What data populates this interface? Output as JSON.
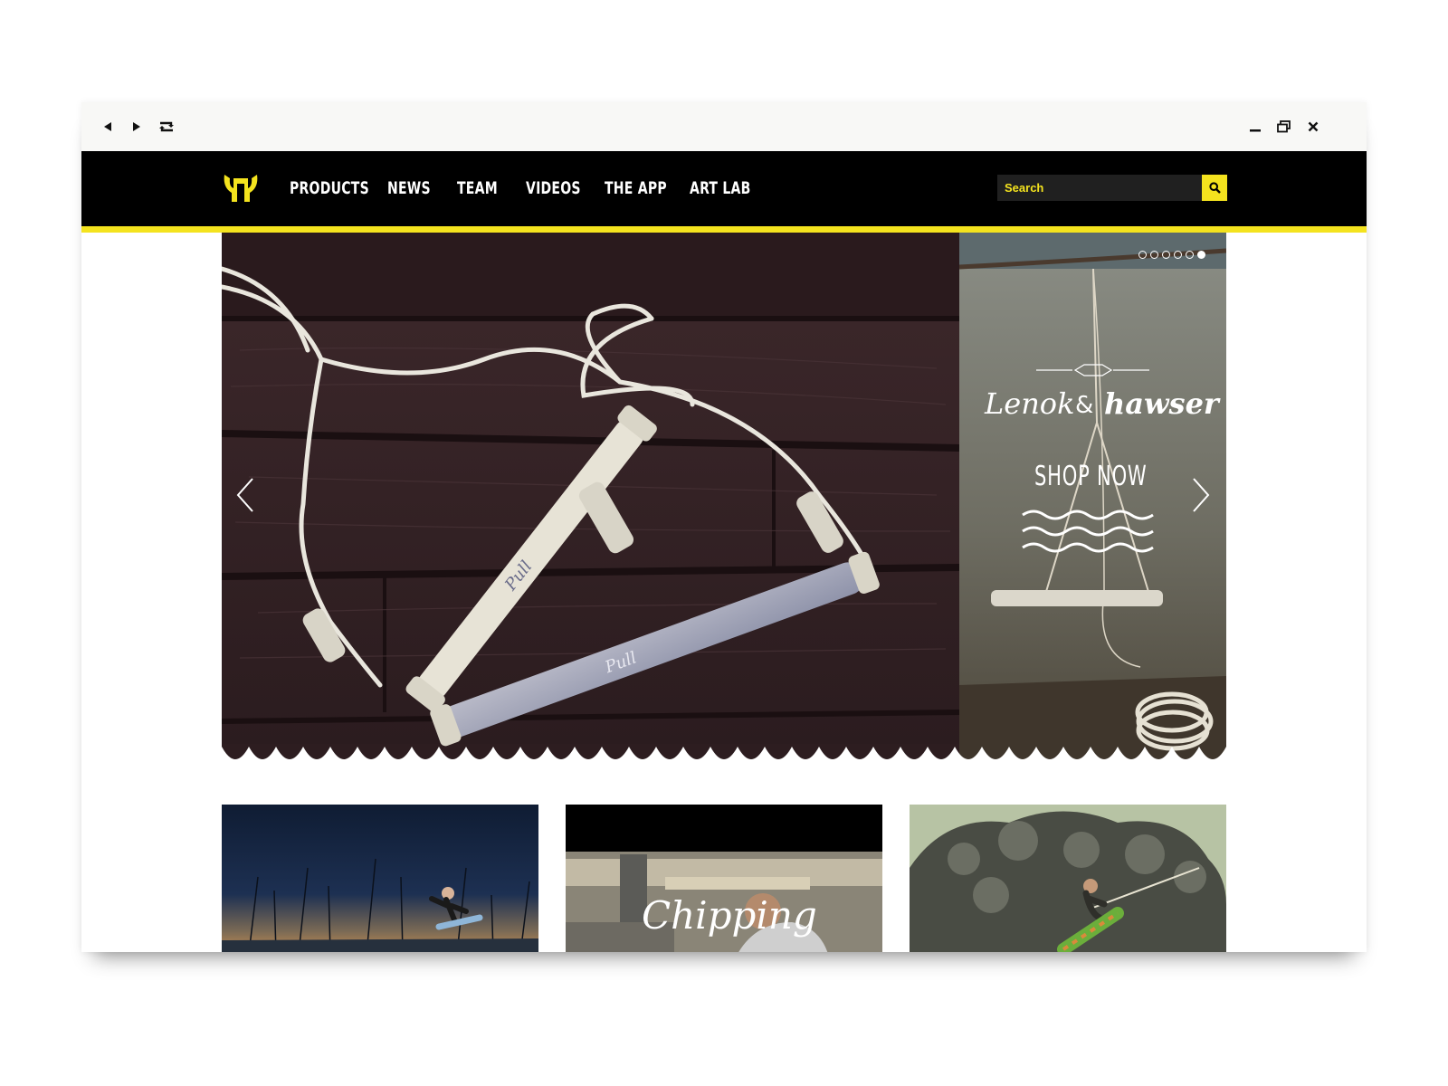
{
  "window": {
    "controls": [
      "back-icon",
      "forward-icon",
      "repeat-icon",
      "minimize-icon",
      "restore-icon",
      "close-icon"
    ]
  },
  "nav": {
    "items": [
      {
        "label": "PRODUCTS"
      },
      {
        "label": "NEWS"
      },
      {
        "label": "TEAM"
      },
      {
        "label": "VIDEOS"
      },
      {
        "label": "THE APP"
      },
      {
        "label": "ART LAB"
      }
    ],
    "search_placeholder": "Search"
  },
  "colors": {
    "accent": "#f4e31e",
    "navbar": "#000000"
  },
  "hero": {
    "brand_left": "Lenok",
    "brand_amp": "&",
    "brand_right": "hawser",
    "cta": "SHOP NOW",
    "slide_count": 6,
    "active_slide": 6
  },
  "thumbs": [
    {
      "caption": ""
    },
    {
      "caption": "Chipping"
    },
    {
      "caption": ""
    }
  ]
}
